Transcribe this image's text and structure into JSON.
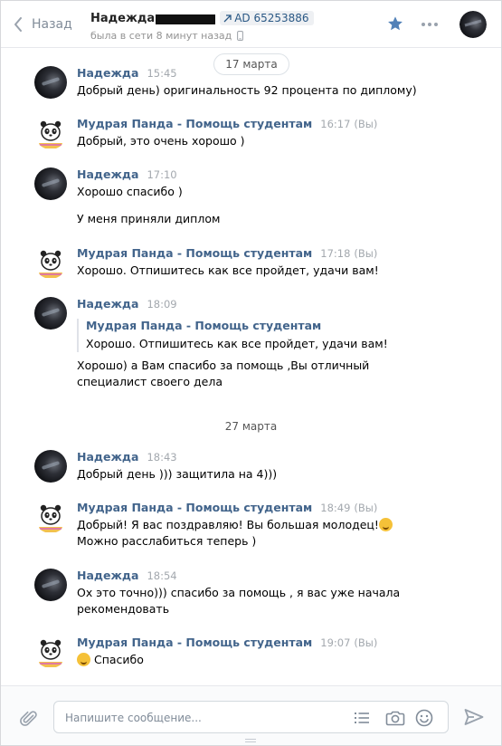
{
  "header": {
    "back_label": "Назад",
    "peer_name": "Надежда",
    "ad_label": "AD 65253886",
    "status": "была в сети 8 минут назад"
  },
  "dates": [
    "17 марта",
    "27 марта"
  ],
  "messages": [
    {
      "author": "Надежда",
      "time": "15:45",
      "tag": "",
      "avatar": "dark-avatar",
      "lines": [
        "Добрый день) оригинальность 92 процента по диплому)"
      ]
    },
    {
      "author": "Мудрая Панда - Помощь студентам",
      "time": "16:17",
      "tag": "(Вы)",
      "avatar": "panda-avatar",
      "lines": [
        "Добрый, это очень хорошо )"
      ]
    },
    {
      "author": "Надежда",
      "time": "17:10",
      "tag": "",
      "avatar": "dark-avatar",
      "lines": [
        "Хорошо спасибо )",
        "У меня приняли диплом"
      ]
    },
    {
      "author": "Мудрая Панда - Помощь студентам",
      "time": "17:18",
      "tag": "(Вы)",
      "avatar": "panda-avatar",
      "lines": [
        "Хорошо. Отпишитесь как все пройдет, удачи вам!"
      ]
    },
    {
      "author": "Надежда",
      "time": "18:09",
      "tag": "",
      "avatar": "dark-avatar",
      "forward": {
        "author": "Мудрая Панда - Помощь студентам",
        "text": "Хорошо. Отпишитесь как все пройдет, удачи вам!"
      },
      "lines": [
        "Хорошо) а Вам спасибо за помощь ,Вы отличный специалист своего дела"
      ]
    },
    {
      "author": "Надежда",
      "time": "18:43",
      "tag": "",
      "avatar": "dark-avatar",
      "lines": [
        "Добрый день ))) защитила на 4)))"
      ]
    },
    {
      "author": "Мудрая Панда - Помощь студентам",
      "time": "18:49",
      "tag": "(Вы)",
      "avatar": "panda-avatar",
      "lines": [
        "Добрый! Я вас поздравляю! Вы большая молодец!",
        "Можно расслабиться теперь )"
      ]
    },
    {
      "author": "Надежда",
      "time": "18:54",
      "tag": "",
      "avatar": "dark-avatar",
      "lines": [
        "Ох это точно))) спасибо за помощь , я вас уже начала рекомендовать"
      ]
    },
    {
      "author": "Мудрая Панда - Помощь студентам",
      "time": "19:07",
      "tag": "(Вы)",
      "avatar": "panda-avatar",
      "lines": [
        "Спасибо"
      ]
    }
  ],
  "composer": {
    "placeholder": "Напишите сообщение..."
  },
  "icons": {
    "back": "chevron-left-icon",
    "ad": "arrow-up-right-icon",
    "status": "mobile-phone-icon",
    "star": "star-icon",
    "more": "more-dots-icon",
    "attach": "paperclip-icon",
    "template": "list-icon",
    "camera": "camera-icon",
    "emoji": "smile-icon",
    "send": "send-icon"
  },
  "colors": {
    "link": "#42648b",
    "accent": "#5181b8",
    "muted": "#818c99"
  }
}
